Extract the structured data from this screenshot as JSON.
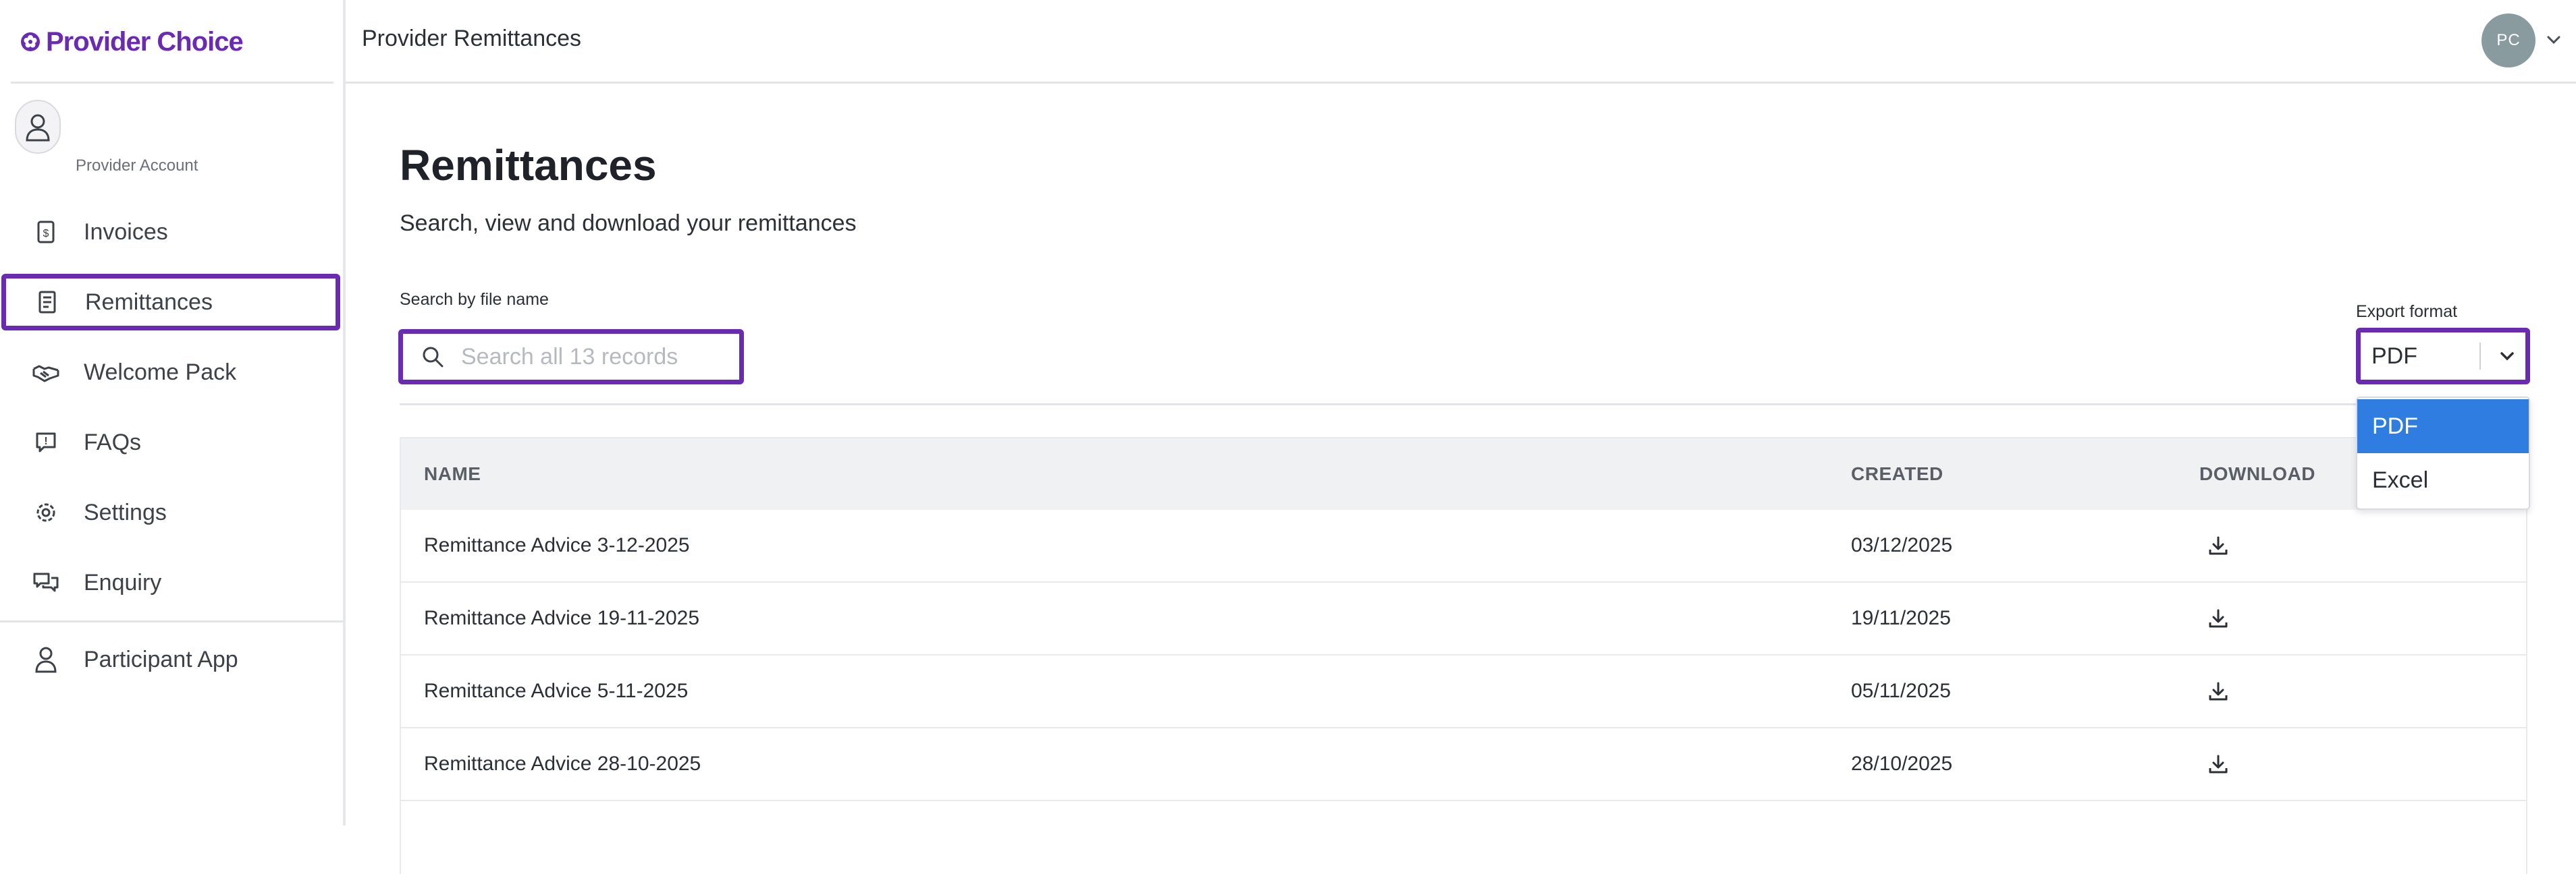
{
  "brand": {
    "name": "Provider Choice",
    "color": "#6a2bb3"
  },
  "account": {
    "label": "Provider Account"
  },
  "sidebar": {
    "items": [
      {
        "label": "Invoices",
        "icon": "invoice-icon"
      },
      {
        "label": "Remittances",
        "icon": "receipt-icon",
        "active": true
      },
      {
        "label": "Welcome Pack",
        "icon": "handshake-icon"
      },
      {
        "label": "FAQs",
        "icon": "faq-icon"
      },
      {
        "label": "Settings",
        "icon": "gear-icon"
      },
      {
        "label": "Enquiry",
        "icon": "chat-icon"
      },
      {
        "label": "Participant App",
        "icon": "person-icon"
      }
    ]
  },
  "header": {
    "title": "Provider Remittances",
    "user_initials": "PC"
  },
  "main": {
    "title": "Remittances",
    "subtitle": "Search, view and download your remittances",
    "search": {
      "label": "Search by file name",
      "placeholder": "Search all 13 records",
      "value": ""
    },
    "export": {
      "label": "Export format",
      "selected": "PDF",
      "options": [
        {
          "label": "PDF",
          "selected": true
        },
        {
          "label": "Excel",
          "selected": false
        }
      ]
    },
    "table": {
      "columns": [
        "NAME",
        "CREATED",
        "DOWNLOAD"
      ],
      "rows": [
        {
          "name": "Remittance Advice 3-12-2025",
          "created": "03/12/2025"
        },
        {
          "name": "Remittance Advice 19-11-2025",
          "created": "19/11/2025"
        },
        {
          "name": "Remittance Advice 5-11-2025",
          "created": "05/11/2025"
        },
        {
          "name": "Remittance Advice 28-10-2025",
          "created": "28/10/2025"
        }
      ]
    }
  },
  "colors": {
    "accent": "#6a2bb3",
    "selected_option": "#2f7de1",
    "table_header_bg": "#f0f1f3"
  }
}
